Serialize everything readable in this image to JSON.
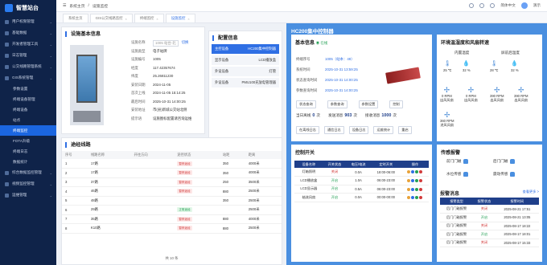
{
  "app": {
    "title": "智慧站台"
  },
  "sidebar": {
    "items": [
      {
        "label": "用户权限管理",
        "type": "top"
      },
      {
        "label": "基础数据",
        "type": "top"
      },
      {
        "label": "开发者管理工具",
        "type": "top"
      },
      {
        "label": "日志管理",
        "type": "top"
      },
      {
        "label": "公交线路管理系统",
        "type": "top"
      },
      {
        "label": "GIS系统管理",
        "type": "top"
      },
      {
        "label": "参数设置",
        "type": "sub"
      },
      {
        "label": "终端设备管理",
        "type": "sub"
      },
      {
        "label": "终端设备",
        "type": "sub"
      },
      {
        "label": "站点",
        "type": "sub"
      },
      {
        "label": "终端监控",
        "type": "sub"
      },
      {
        "label": "FOTA升级",
        "type": "sub"
      },
      {
        "label": "终端日志",
        "type": "sub"
      },
      {
        "label": "数据统计",
        "type": "sub"
      },
      {
        "label": "综合数据监控管理",
        "type": "top"
      },
      {
        "label": "视频监控管理",
        "type": "top"
      },
      {
        "label": "运维管理",
        "type": "top"
      }
    ]
  },
  "topbar": {
    "crumb_home": "系统主页",
    "crumb_sep": "/",
    "crumb_current": "设施监控",
    "lang": "简体中文",
    "user": "演示"
  },
  "tabs": [
    "系统主页",
    "GIS公交线路监控",
    "终端监控",
    "设施监控"
  ],
  "facility": {
    "title": "设施基本信息",
    "fields": [
      {
        "k": "设施名称",
        "v": "1005 站台-北",
        "extra": "切换"
      },
      {
        "k": "设施类型",
        "v": "电子站牌"
      },
      {
        "k": "设施编号",
        "v": "1005"
      },
      {
        "k": "经度",
        "v": "117.42357674"
      },
      {
        "k": "纬度",
        "v": "25.26811230"
      },
      {
        "k": "安装日期",
        "v": "2024-11-05"
      },
      {
        "k": "首次上线",
        "v": "2024-11-05 15:14:25"
      },
      {
        "k": "最后时间",
        "v": "2025-10-31 14:00:25"
      },
      {
        "k": "安装地址",
        "v": "市(县)新城公交站北侧"
      },
      {
        "k": "提示语",
        "v": "设施图标配置请咨询运维"
      }
    ]
  },
  "config": {
    "title": "配置信息",
    "rows": [
      {
        "k": "主控设备",
        "v": "HC200集中控制器",
        "active": true
      },
      {
        "k": "显示设备",
        "v": "LCD播放盒",
        "active": false
      },
      {
        "k": "外设设备",
        "v": "灯管",
        "active": false
      },
      {
        "k": "外设设备",
        "v": "PMU100充放电管理器",
        "active": false
      }
    ]
  },
  "routes": {
    "title": "途经线路",
    "headers": [
      "序号",
      "线路名称",
      "开往方向",
      "途径状态",
      "站距",
      "距离"
    ],
    "rows": [
      [
        "1",
        "17路",
        "",
        "暂停途经",
        "350",
        "4000米"
      ],
      [
        "2",
        "17路",
        "",
        "暂停途经",
        "350",
        "4000米"
      ],
      [
        "3",
        "37路",
        "",
        "暂停途经",
        "250",
        "3500米"
      ],
      [
        "4",
        "46路",
        "",
        "暂停途经",
        "880",
        "2500米"
      ],
      [
        "5",
        "48路",
        "",
        "",
        "350",
        "2500米"
      ],
      [
        "6",
        "29路",
        "",
        "正常途经",
        "",
        "2500米"
      ],
      [
        "7",
        "35路",
        "",
        "暂停途经",
        "880",
        "4000米"
      ],
      [
        "8",
        "K10路",
        "",
        "暂停途经",
        "880",
        "2500米"
      ]
    ],
    "pager": "共 10 条"
  },
  "controller": {
    "title": "HC200集中控制器",
    "basic_title": "基本信息",
    "online": "在线",
    "fields": [
      {
        "k": "终端序号",
        "v": "1005（站本：49）"
      },
      {
        "k": "系统时间",
        "v": "2025-10-31 13:59:25"
      },
      {
        "k": "状态查询时间",
        "v": "2025-10-31 14:00:25"
      },
      {
        "k": "参数查询时间",
        "v": "2025-10-31 14:00:25"
      }
    ],
    "buttons": [
      "状态查询",
      "参数查询",
      "参数设置",
      "控制"
    ],
    "counts": [
      {
        "k": "当日离线",
        "v": "0",
        "u": "次"
      },
      {
        "k": "发送消息",
        "v": "903",
        "u": "次"
      },
      {
        "k": "接收消息",
        "v": "1000",
        "u": "次"
      }
    ],
    "buttons2": [
      "在离线日志",
      "通信日志",
      "设备日志",
      "运维统计",
      "重启"
    ]
  },
  "env": {
    "title": "环境温湿度和风扇转速",
    "temp_in": "内置温度",
    "temp_out": "屏前后温度",
    "temps": [
      "25 ℃",
      "32 %",
      "28 ℃",
      "32 %"
    ],
    "fans": [
      "0 RPM",
      "0 RPM",
      "390 RPM",
      "390 RPM",
      "360 RPM"
    ],
    "fan_labels": [
      "出风风扇",
      "出风风扇",
      "出风风扇",
      "出风风扇",
      "进风风扇"
    ]
  },
  "switches": {
    "title": "控制开关",
    "headers": [
      "设备名称",
      "开关状态",
      "电压/电流",
      "定时开关",
      "操作"
    ],
    "rows": [
      [
        "灯箱照明",
        "关闭",
        "0.0A",
        "18:00-06:00"
      ],
      [
        "LCD播放盒",
        "开启",
        "1.0A",
        "06:00-23:00"
      ],
      [
        "LCD显示器",
        "开启",
        "0.5A",
        "06:00-23:00"
      ],
      [
        "轴流风扇",
        "开启",
        "0.0A",
        "00:00-00:00"
      ]
    ]
  },
  "alarms": {
    "title": "传感报警",
    "items": [
      "前门门磁",
      "后门门磁",
      "水位传感",
      "震动传感"
    ],
    "msg_title": "报警消息",
    "more": "查看更多 >",
    "headers": [
      "报警类型",
      "报警状态",
      "报警时间"
    ],
    "rows": [
      [
        "后门门磁报警",
        "关闭",
        "2025-08-21 17:51"
      ],
      [
        "后门门磁报警",
        "开启",
        "2025-08-21 13:05"
      ],
      [
        "后门门磁报警",
        "关闭",
        "2025-08-17 18:22"
      ],
      [
        "后门门磁报警",
        "开启",
        "2025-08-17 18:01"
      ],
      [
        "后门门磁报警",
        "关闭",
        "2025-08-17 15:33"
      ]
    ]
  },
  "colors": {
    "accent": "#2f6fe4",
    "sidebar": "#0f2349",
    "danger": "#d23a3a",
    "ok": "#23a055"
  }
}
